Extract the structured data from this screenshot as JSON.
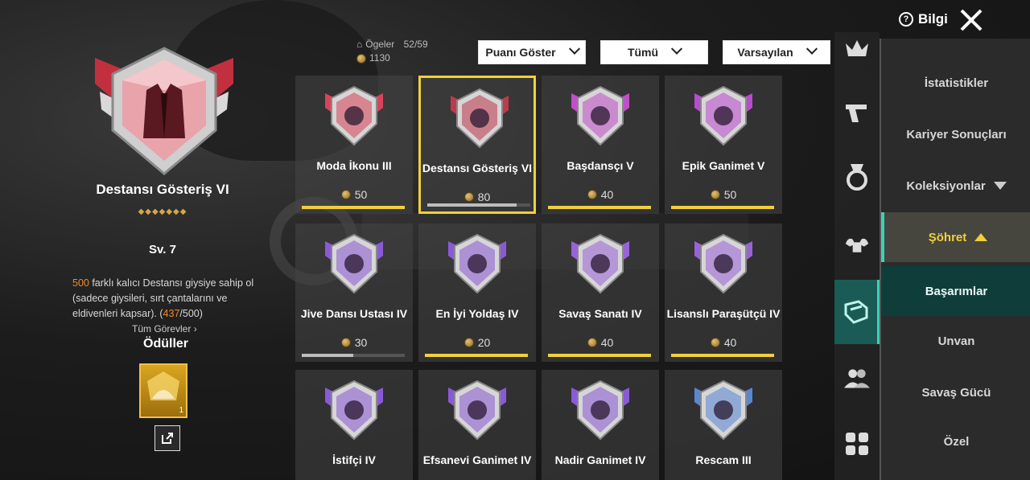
{
  "colors": {
    "accent": "#f0d03a",
    "teal": "#3ed1b6",
    "highlight_orange": "#f08a2a"
  },
  "header": {
    "info_label": "Bilgi",
    "close_icon": "close-icon",
    "info_icon": "question-icon"
  },
  "stats": {
    "items_label": "Ögeler",
    "items_value": "52/59",
    "points": "1130"
  },
  "filters": {
    "points": "Puanı Göster",
    "category": "Tümü",
    "sort": "Varsayılan"
  },
  "detail": {
    "title": "Destansı Gösteriş VI",
    "stars": "◆◆◆◆◆◆◆",
    "level": "Sv. 7",
    "desc_count": "500",
    "desc_text": " farklı kalıcı Destansı giysiye sahip ol (sadece giysileri, sırt çantalarını ve eldivenleri kapsar). (",
    "desc_progress": "437",
    "desc_total": "/500)",
    "all_tasks": "Tüm Görevler",
    "rewards_label": "Ödüller",
    "reward_count": "1"
  },
  "achievements": [
    {
      "name": "Moda İkonu III",
      "points": "50",
      "progress": 1.0,
      "bar": "yellow",
      "color": "#d9435a"
    },
    {
      "name": "Destansı Gösteriş VI",
      "points": "80",
      "progress": 0.87,
      "bar": "grey",
      "color": "#c0394c",
      "selected": true
    },
    {
      "name": "Başdansçı V",
      "points": "40",
      "progress": 1.0,
      "bar": "yellow",
      "color": "#c14fc9"
    },
    {
      "name": "Epik Ganimet V",
      "points": "50",
      "progress": 1.0,
      "bar": "yellow",
      "color": "#b94bd0"
    },
    {
      "name": "Jive Dansı Ustası IV",
      "points": "30",
      "progress": 0.5,
      "bar": "grey",
      "color": "#8a5ad6"
    },
    {
      "name": "En İyi Yoldaş IV",
      "points": "20",
      "progress": 1.0,
      "bar": "yellow",
      "color": "#8a5ad6"
    },
    {
      "name": "Savaş Sanatı IV",
      "points": "40",
      "progress": 1.0,
      "bar": "yellow",
      "color": "#9a62d8"
    },
    {
      "name": "Lisanslı Paraşütçü IV",
      "points": "40",
      "progress": 1.0,
      "bar": "yellow",
      "color": "#9a62d8"
    },
    {
      "name": "İstifçi IV",
      "points": "",
      "progress": 0,
      "bar": "none",
      "color": "#8a5ad6"
    },
    {
      "name": "Efsanevi Ganimet IV",
      "points": "",
      "progress": 0,
      "bar": "none",
      "color": "#8a5ad6"
    },
    {
      "name": "Nadir Ganimet IV",
      "points": "",
      "progress": 0,
      "bar": "none",
      "color": "#8a5ad6"
    },
    {
      "name": "Rescam III",
      "points": "",
      "progress": 0,
      "bar": "none",
      "color": "#5a86d6"
    }
  ],
  "sidebar_icons": [
    "crown-icon",
    "pistol-icon",
    "medal-icon",
    "muscle-icon",
    "collection-icon",
    "friends-icon",
    "grid-icon"
  ],
  "menu": {
    "stats": "İstatistikler",
    "career": "Kariyer Sonuçları",
    "collections": "Koleksiyonlar",
    "fame": "Şöhret",
    "achievements": "Başarımlar",
    "title": "Unvan",
    "power": "Savaş Gücü",
    "special": "Özel"
  }
}
